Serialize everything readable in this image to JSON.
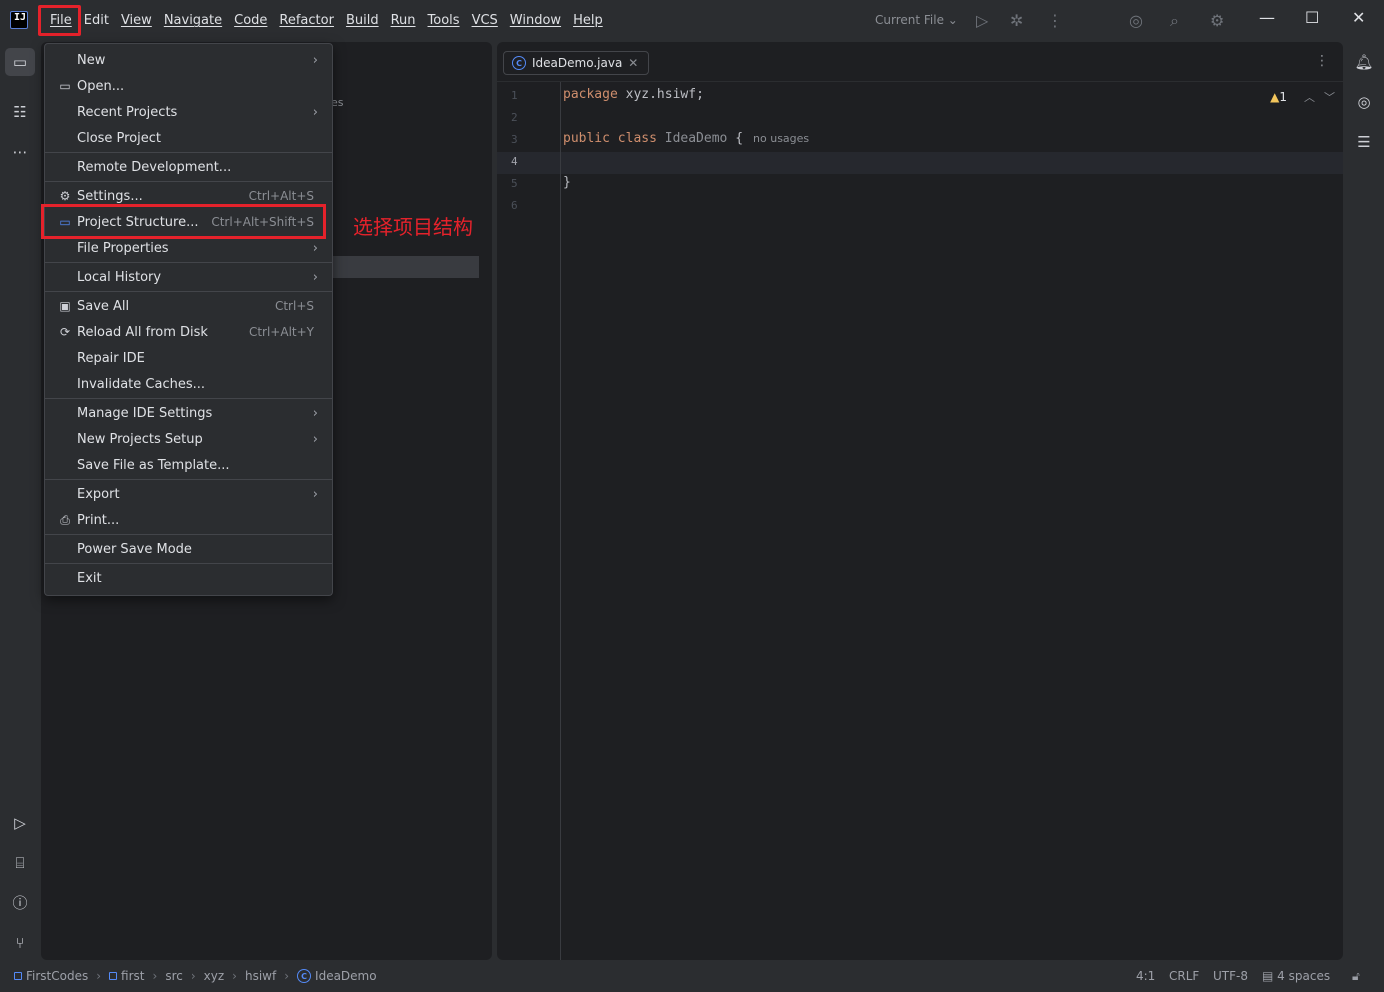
{
  "menubar": {
    "items": [
      "File",
      "Edit",
      "View",
      "Navigate",
      "Code",
      "Refactor",
      "Build",
      "Run",
      "Tools",
      "VCS",
      "Window",
      "Help"
    ],
    "run_config": "Current File"
  },
  "file_menu": {
    "items": [
      {
        "label": "New",
        "shortcut": "",
        "submenu": true,
        "icon": ""
      },
      {
        "label": "Open...",
        "shortcut": "",
        "submenu": false,
        "icon": "folder-icon"
      },
      {
        "label": "Recent Projects",
        "shortcut": "",
        "submenu": true,
        "icon": ""
      },
      {
        "label": "Close Project",
        "shortcut": "",
        "submenu": false,
        "icon": ""
      },
      {
        "label": "Remote Development...",
        "shortcut": "",
        "submenu": false,
        "icon": ""
      },
      {
        "label": "Settings...",
        "shortcut": "Ctrl+Alt+S",
        "submenu": false,
        "icon": "gear-icon"
      },
      {
        "label": "Project Structure...",
        "shortcut": "Ctrl+Alt+Shift+S",
        "submenu": false,
        "icon": "project-structure-icon"
      },
      {
        "label": "File Properties",
        "shortcut": "",
        "submenu": true,
        "icon": ""
      },
      {
        "label": "Local History",
        "shortcut": "",
        "submenu": true,
        "icon": ""
      },
      {
        "label": "Save All",
        "shortcut": "Ctrl+S",
        "submenu": false,
        "icon": "save-icon"
      },
      {
        "label": "Reload All from Disk",
        "shortcut": "Ctrl+Alt+Y",
        "submenu": false,
        "icon": "reload-icon"
      },
      {
        "label": "Repair IDE",
        "shortcut": "",
        "submenu": false,
        "icon": ""
      },
      {
        "label": "Invalidate Caches...",
        "shortcut": "",
        "submenu": false,
        "icon": ""
      },
      {
        "label": "Manage IDE Settings",
        "shortcut": "",
        "submenu": true,
        "icon": ""
      },
      {
        "label": "New Projects Setup",
        "shortcut": "",
        "submenu": true,
        "icon": ""
      },
      {
        "label": "Save File as Template...",
        "shortcut": "",
        "submenu": false,
        "icon": ""
      },
      {
        "label": "Export",
        "shortcut": "",
        "submenu": true,
        "icon": ""
      },
      {
        "label": "Print...",
        "shortcut": "",
        "submenu": false,
        "icon": "print-icon"
      },
      {
        "label": "Power Save Mode",
        "shortcut": "",
        "submenu": false,
        "icon": ""
      },
      {
        "label": "Exit",
        "shortcut": "",
        "submenu": false,
        "icon": ""
      }
    ]
  },
  "annotation": "选择项目结构",
  "project_panel": {
    "partial_text": "es"
  },
  "editor": {
    "tab_label": "IdeaDemo.java",
    "line_numbers": [
      "1",
      "2",
      "3",
      "4",
      "5",
      "6"
    ],
    "lines": {
      "l1_kw": "package",
      "l1_rest": " xyz.hsiwf;",
      "l3_kw": "public class",
      "l3_cls": " IdeaDemo",
      "l3_brace": " {",
      "l3_hint": "no usages",
      "l5": "}"
    },
    "warning_count": "1"
  },
  "statusbar": {
    "crumbs": [
      "FirstCodes",
      "first",
      "src",
      "xyz",
      "hsiwf",
      "IdeaDemo"
    ],
    "position": "4:1",
    "line_sep": "CRLF",
    "encoding": "UTF-8",
    "indent": "4 spaces"
  },
  "colors": {
    "accent": "#548af7",
    "highlight": "#e5222b",
    "keyword": "#cf8e6d"
  }
}
